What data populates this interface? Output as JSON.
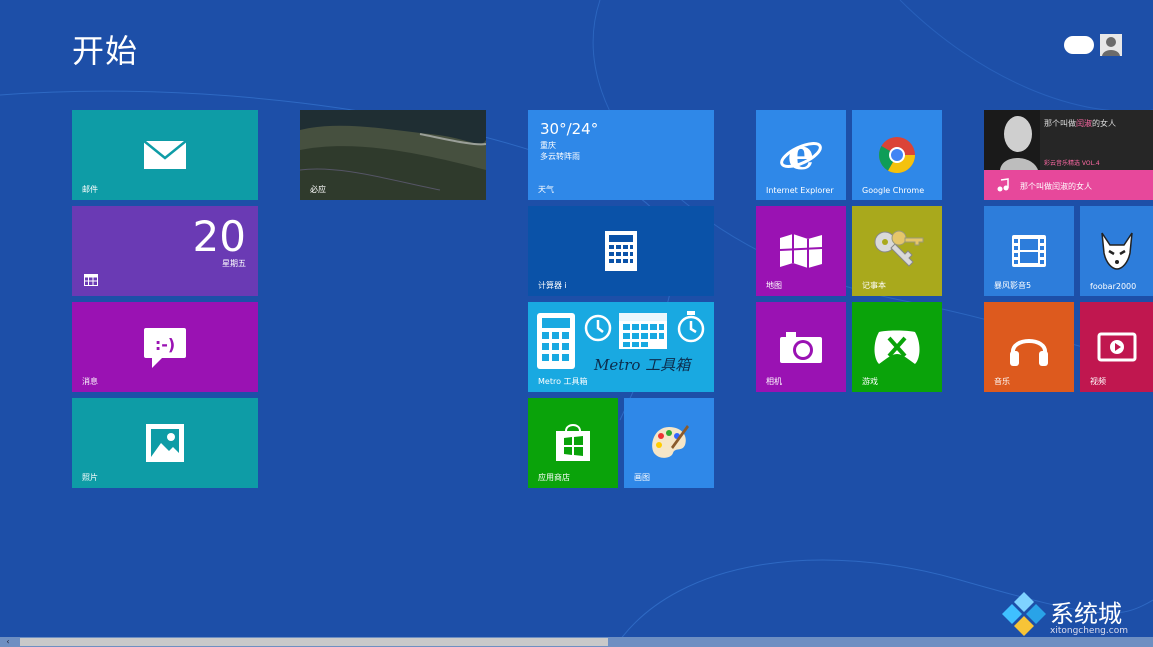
{
  "start": {
    "title": "开始"
  },
  "tiles": {
    "mail": {
      "label": "邮件",
      "icon": "mail-icon"
    },
    "photo_map": {
      "label": "必应"
    },
    "weather": {
      "temp": "30°/24°",
      "city": "重庆",
      "condition": "多云转阵雨",
      "label": "天气"
    },
    "calendar": {
      "date": "20",
      "weekday": "星期五"
    },
    "calculator": {
      "label": "计算器 i"
    },
    "messaging": {
      "label": "消息"
    },
    "metro_tools": {
      "text": "Metro 工具箱",
      "label": "Metro 工具箱"
    },
    "photos": {
      "label": "照片"
    },
    "store": {
      "label": "应用商店"
    },
    "paint": {
      "label": "画图"
    },
    "ie": {
      "label": "Internet Explorer"
    },
    "chrome": {
      "label": "Google Chrome"
    },
    "maps": {
      "label": "地图"
    },
    "keys": {
      "label": "记事本"
    },
    "camera": {
      "label": "相机"
    },
    "xbox": {
      "label": "游戏"
    },
    "hero": {
      "headline": "那个叫做",
      "headline_accent": "闰淑",
      "headline_tail": "的女人",
      "sub": "彩云音乐精选 VOL.4",
      "bar_label": "那个叫做闰淑的女人"
    },
    "video_player": {
      "label": "暴风影音5"
    },
    "foobar": {
      "label": "foobar2000"
    },
    "music": {
      "label": "音乐"
    },
    "video": {
      "label": "视频"
    }
  },
  "watermark": {
    "text": "系统城",
    "url": "xitongcheng.com"
  },
  "colors": {
    "background": "#1d4fa8",
    "teal": "#0e9ca6",
    "purple": "#6a3ab4",
    "magenta": "#9a12b3",
    "blue": "#2f88e8",
    "green": "#0aa30a",
    "orange": "#dd5a1e",
    "crimson": "#c0174f",
    "pink": "#e7489b"
  }
}
